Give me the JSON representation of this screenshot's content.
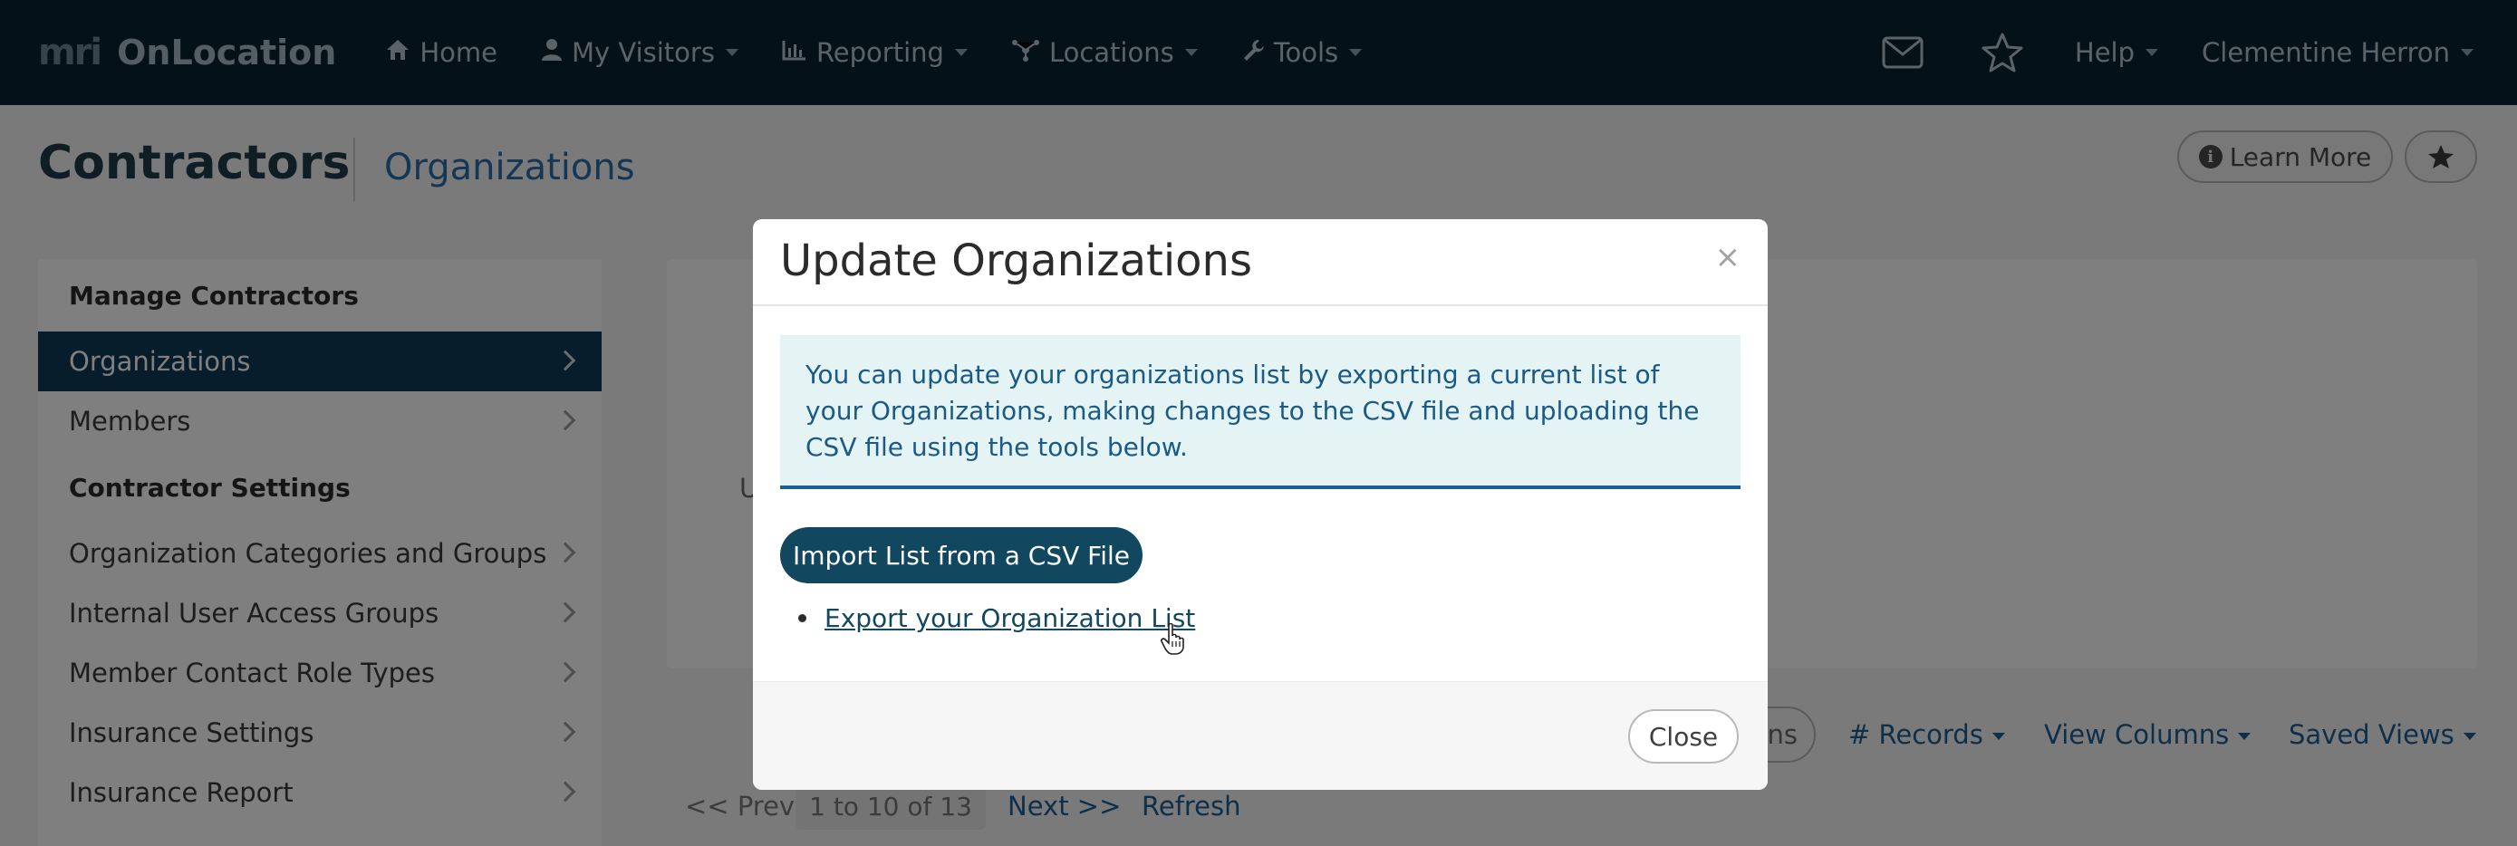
{
  "nav": {
    "brand_logo": "mri",
    "brand_name": "OnLocation",
    "items": [
      {
        "label": "Home",
        "icon": "home-icon",
        "dropdown": false
      },
      {
        "label": "My Visitors",
        "icon": "user-icon",
        "dropdown": true
      },
      {
        "label": "Reporting",
        "icon": "chart-icon",
        "dropdown": true
      },
      {
        "label": "Locations",
        "icon": "network-icon",
        "dropdown": true
      },
      {
        "label": "Tools",
        "icon": "wrench-icon",
        "dropdown": true
      }
    ],
    "help_label": "Help",
    "user_name": "Clementine Herron"
  },
  "page": {
    "title": "Contractors",
    "subtitle": "Organizations",
    "learn_more": "Learn More"
  },
  "sidebar": {
    "section1": "Manage Contractors",
    "section2": "Contractor Settings",
    "items": [
      {
        "label": "Organizations",
        "active": true
      },
      {
        "label": "Members",
        "active": false
      },
      {
        "label": "Organization Categories and Groups",
        "active": false
      },
      {
        "label": "Internal User Access Groups",
        "active": false
      },
      {
        "label": "Member Contact Role Types",
        "active": false
      },
      {
        "label": "Insurance Settings",
        "active": false
      },
      {
        "label": "Insurance Report",
        "active": false
      }
    ]
  },
  "main": {
    "partial_letter": "U",
    "toolbar": {
      "partial_button": "ns",
      "records": "# Records",
      "view_columns": "View Columns",
      "saved_views": "Saved Views"
    },
    "pager": {
      "prev": "<< Prev",
      "range": "1 to 10 of 13",
      "next": "Next >>",
      "refresh": "Refresh"
    }
  },
  "modal": {
    "title": "Update Organizations",
    "close_x": "×",
    "info_text": "You can update your organizations list by exporting a current list of your Organizations, making changes to the CSV file and uploading the CSV file using the tools below.",
    "import_button": "Import List from a CSV File",
    "export_link": "Export your Organization List",
    "close_button": "Close"
  },
  "colors": {
    "navbar": "#0b2233",
    "primary": "#11475f",
    "active_sidebar": "#0e3b56",
    "link": "#1d5f95",
    "alert_bg": "#e4f3f4"
  }
}
